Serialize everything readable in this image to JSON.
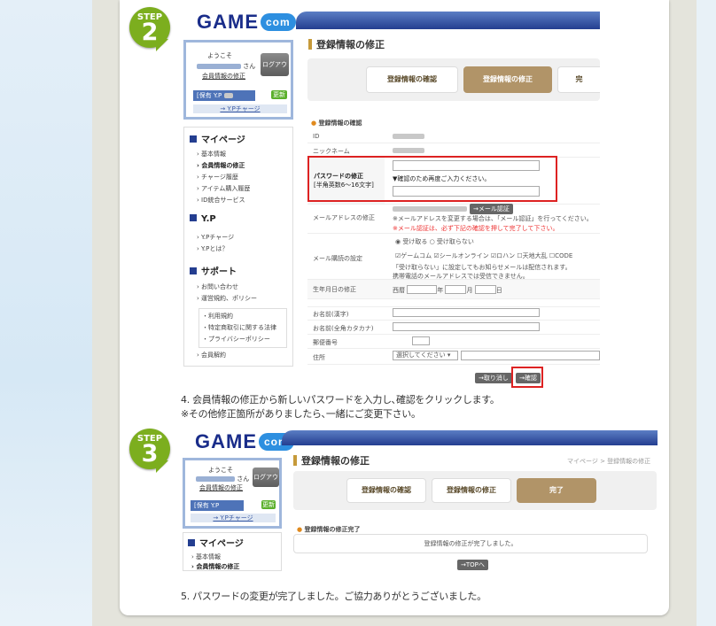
{
  "step2": {
    "badge_label": "STEP",
    "badge_number": "2",
    "logo_main": "GAME",
    "logo_com": "com",
    "login": {
      "welcome": "ようこそ",
      "san": "さん",
      "edit_link": "会員情報の修正",
      "logout_button": "ログアウト",
      "yp_label": "[保有 Y.P",
      "update_button": "更新",
      "charge_link": "→ Y.Pチャージ"
    },
    "sidebar": {
      "mypage_title": "マイページ",
      "mypage_items": [
        "基本情報",
        "会員情報の修正",
        "チャージ履歴",
        "アイテム購入履歴",
        "ID統合サービス"
      ],
      "yp_title": "Y.P",
      "yp_items": [
        "Y.Pチャージ",
        "Y.Pとは？"
      ],
      "support_title": "サポート",
      "support_items": [
        "お問い合わせ",
        "運営規約、ポリシー"
      ],
      "policy_items": [
        "・利用規約",
        "・特定商取引に関する法律",
        "・プライバシーポリシー"
      ],
      "cancel_item": "会員解約"
    },
    "page_title": "登録情報の修正",
    "steps": [
      "登録情報の確認",
      "登録情報の修正",
      "完"
    ],
    "section_heading": "登録情報の確認",
    "fields": {
      "id": "ID",
      "nickname": "ニックネーム",
      "password_label": "パスワードの修正",
      "password_hint": "[半角英数6〜16文字]",
      "password_confirm": "▼確認のため再度ご入力ください。",
      "mail_label": "メールアドレスの修正",
      "mail_auth_button": "→メール認証",
      "mail_note1": "※メールアドレスを変更する場合は、「メール認証」を行ってください。",
      "mail_note2": "※メール認証は、必ず下記の確認を押して完了して下さい。",
      "subscribe_label": "メール購読の設定",
      "receive": "受け取る",
      "not_receive": "受け取らない",
      "services": [
        "ゲームコム",
        "シールオンライン",
        "ロハン",
        "天地大乱",
        "CODE"
      ],
      "sub_note1": "「受け取らない」に設定してもお知らせメールは配信されます。",
      "sub_note2": "携帯電話のメールアドレスでは受信できません。",
      "birth_label": "生年月日の修正",
      "era": "西暦",
      "year": "年",
      "month": "月",
      "day": "日",
      "name_kanji": "お名前(漢字)",
      "name_kana": "お名前(全角カタカナ)",
      "postal": "郵便番号",
      "address": "住所",
      "address_select": "選択してください"
    },
    "cancel_button": "→取り消し",
    "confirm_button": "→確認",
    "caption1": "4. 会員情報の修正から新しいパスワードを入力し､確認をクリックします。",
    "caption2": "※その他修正箇所がありましたら､一緒にご変更下さい。"
  },
  "step3": {
    "badge_label": "STEP",
    "badge_number": "3",
    "logo_main": "GAME",
    "logo_com": "com",
    "login": {
      "welcome": "ようこそ",
      "san": "さん",
      "edit_link": "会員情報の修正",
      "logout_button": "ログアウト",
      "yp_label": "[保有 Y.P",
      "update_button": "更新",
      "charge_link": "→ Y.Pチャージ"
    },
    "sidebar": {
      "mypage_title": "マイページ",
      "mypage_items": [
        "基本情報",
        "会員情報の修正"
      ]
    },
    "page_title": "登録情報の修正",
    "breadcrumb": "マイページ > 登録情報の修正",
    "steps": [
      "登録情報の確認",
      "登録情報の修正",
      "完了"
    ],
    "section_heading": "登録情報の修正完了",
    "done_message": "登録情報の修正が完了しました。",
    "top_button": "→TOPへ",
    "caption": "5. パスワードの変更が完了しました。ご協力ありがとうございました。"
  }
}
